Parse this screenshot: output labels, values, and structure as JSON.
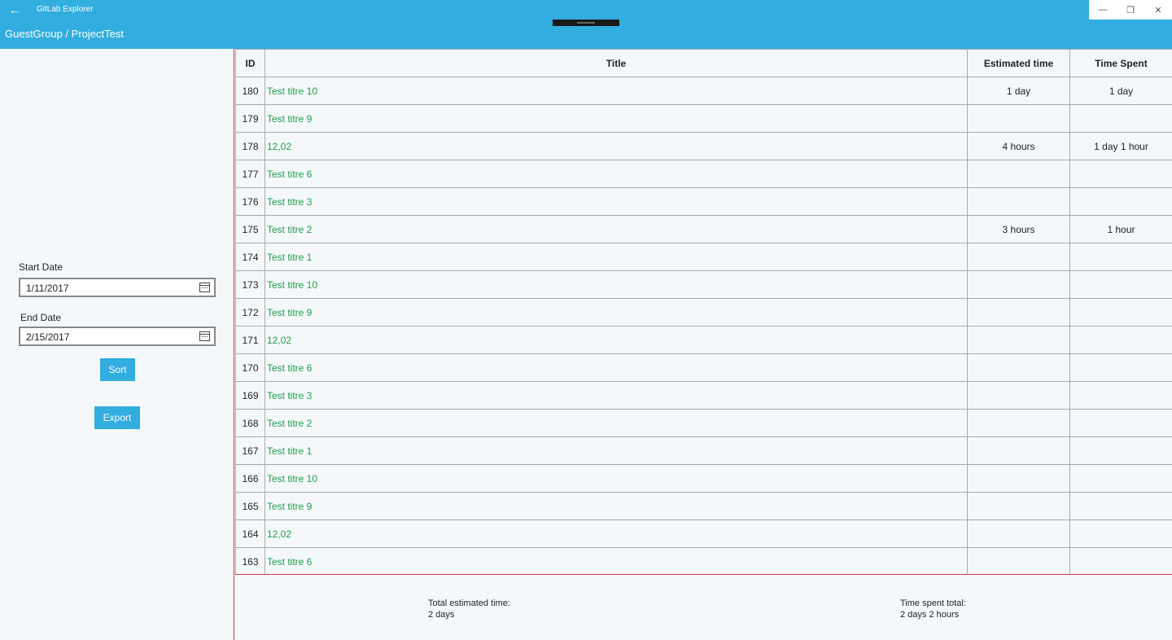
{
  "window": {
    "app_title": "GitLab Explorer",
    "back_glyph": "←",
    "minimize_glyph": "—",
    "restore_glyph": "❐",
    "close_glyph": "✕"
  },
  "header": {
    "breadcrumb": "GuestGroup / ProjectTest"
  },
  "filters": {
    "start_label": "Start Date",
    "start_value": "1/11/2017",
    "end_label": "End Date",
    "end_value": "2/15/2017",
    "sort_label": "Sort",
    "export_label": "Export"
  },
  "table": {
    "columns": [
      "ID",
      "Title",
      "Estimated time",
      "Time Spent"
    ],
    "rows": [
      {
        "id": "180",
        "title": "Test titre 10",
        "est": "1 day",
        "spent": "1 day"
      },
      {
        "id": "179",
        "title": "Test titre 9",
        "est": "",
        "spent": ""
      },
      {
        "id": "178",
        "title": "12,02",
        "est": "4 hours",
        "spent": "1 day 1 hour"
      },
      {
        "id": "177",
        "title": "Test titre 6",
        "est": "",
        "spent": ""
      },
      {
        "id": "176",
        "title": "Test titre 3",
        "est": "",
        "spent": ""
      },
      {
        "id": "175",
        "title": "Test titre 2",
        "est": "3 hours",
        "spent": "1 hour"
      },
      {
        "id": "174",
        "title": "Test titre 1",
        "est": "",
        "spent": ""
      },
      {
        "id": "173",
        "title": "Test titre 10",
        "est": "",
        "spent": ""
      },
      {
        "id": "172",
        "title": "Test titre 9",
        "est": "",
        "spent": ""
      },
      {
        "id": "171",
        "title": "12,02",
        "est": "",
        "spent": ""
      },
      {
        "id": "170",
        "title": "Test titre 6",
        "est": "",
        "spent": ""
      },
      {
        "id": "169",
        "title": "Test titre 3",
        "est": "",
        "spent": ""
      },
      {
        "id": "168",
        "title": "Test titre 2",
        "est": "",
        "spent": ""
      },
      {
        "id": "167",
        "title": "Test titre 1",
        "est": "",
        "spent": ""
      },
      {
        "id": "166",
        "title": "Test titre 10",
        "est": "",
        "spent": ""
      },
      {
        "id": "165",
        "title": "Test titre 9",
        "est": "",
        "spent": ""
      },
      {
        "id": "164",
        "title": "12,02",
        "est": "",
        "spent": ""
      },
      {
        "id": "163",
        "title": "Test titre 6",
        "est": "",
        "spent": ""
      },
      {
        "id": "",
        "title": "",
        "est": "",
        "spent": ""
      }
    ]
  },
  "totals": {
    "estimated_label": "Total estimated time:",
    "estimated_value": "2 days",
    "spent_label": "Time spent total:",
    "spent_value": "2 days 2 hours"
  },
  "colors": {
    "accent": "#32ade0",
    "title_link": "#1f9e48",
    "divider": "#c73b44"
  }
}
